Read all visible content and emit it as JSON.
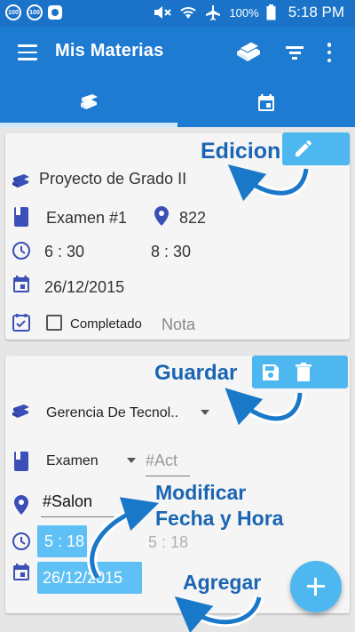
{
  "status_bar": {
    "notif_badge": "100",
    "battery": "100%",
    "time": "5:18 PM"
  },
  "app_bar": {
    "title": "Mis Materias"
  },
  "tabs": [
    {
      "name": "materias",
      "icon": "books-icon",
      "selected": true
    },
    {
      "name": "calendario",
      "icon": "calendar-icon",
      "selected": false
    }
  ],
  "card1": {
    "subject": "Proyecto de Grado II",
    "activity": "Examen #1",
    "room": "822",
    "start_time": "6 : 30",
    "end_time": "8 : 30",
    "date": "26/12/2015",
    "completed_label": "Completado",
    "note_placeholder": "Nota"
  },
  "card2": {
    "subject_selected": "Gerencia De Tecnol..",
    "activity_type": "Examen",
    "activity_placeholder": "#Act",
    "room_placeholder": "#Salon",
    "start_time": "5 : 18",
    "end_time": "5 : 18",
    "date": "26/12/2015"
  },
  "annotations": {
    "edit": "Edicion",
    "save": "Guardar",
    "modify_line1": "Modificar",
    "modify_line2": "Fecha y Hora",
    "add": "Agregar"
  },
  "colors": {
    "primary": "#1e7bd2",
    "accent": "#4fb7f0",
    "icon": "#3b4fb8",
    "annotation": "#1a65b3"
  }
}
